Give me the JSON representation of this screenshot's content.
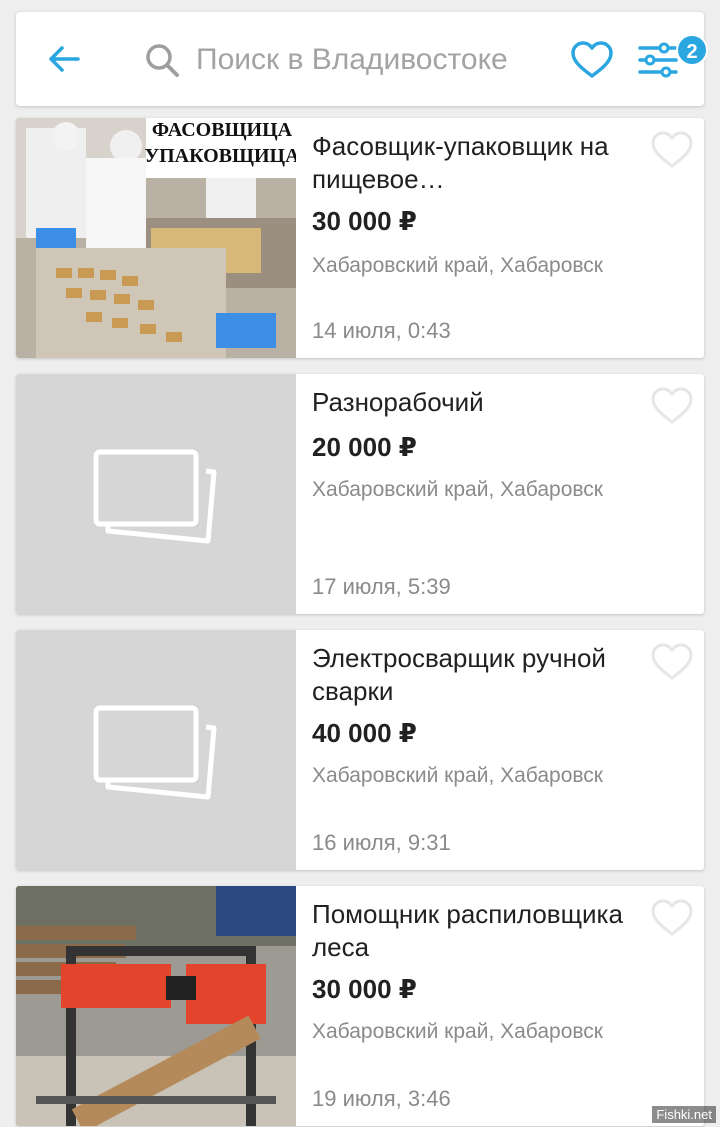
{
  "search": {
    "placeholder": "Поиск в Владивостоке"
  },
  "filters": {
    "badge_count": "2"
  },
  "listings": [
    {
      "title": "Фасовщик-упаковщик на пищевое…",
      "price": "30 000 ₽",
      "location": "Хабаровский край, Хабаровск",
      "date": "14 июля, 0:43",
      "image_caption": "ФАСОВЩИЦА УПАКОВЩИЦА"
    },
    {
      "title": "Разнорабочий",
      "price": "20 000 ₽",
      "location": "Хабаровский край, Хабаровск",
      "date": "17 июля, 5:39"
    },
    {
      "title": "Электросварщик ручной сварки",
      "price": "40 000 ₽",
      "location": "Хабаровский край, Хабаровск",
      "date": "16 июля, 9:31"
    },
    {
      "title": "Помощник распиловщика леса",
      "price": "30 000 ₽",
      "location": "Хабаровский край, Хабаровск",
      "date": "19 июля, 3:46"
    }
  ],
  "watermark": "Fishki.net",
  "colors": {
    "accent": "#2aa6e0",
    "placeholder_bg": "#d6d6d6"
  }
}
